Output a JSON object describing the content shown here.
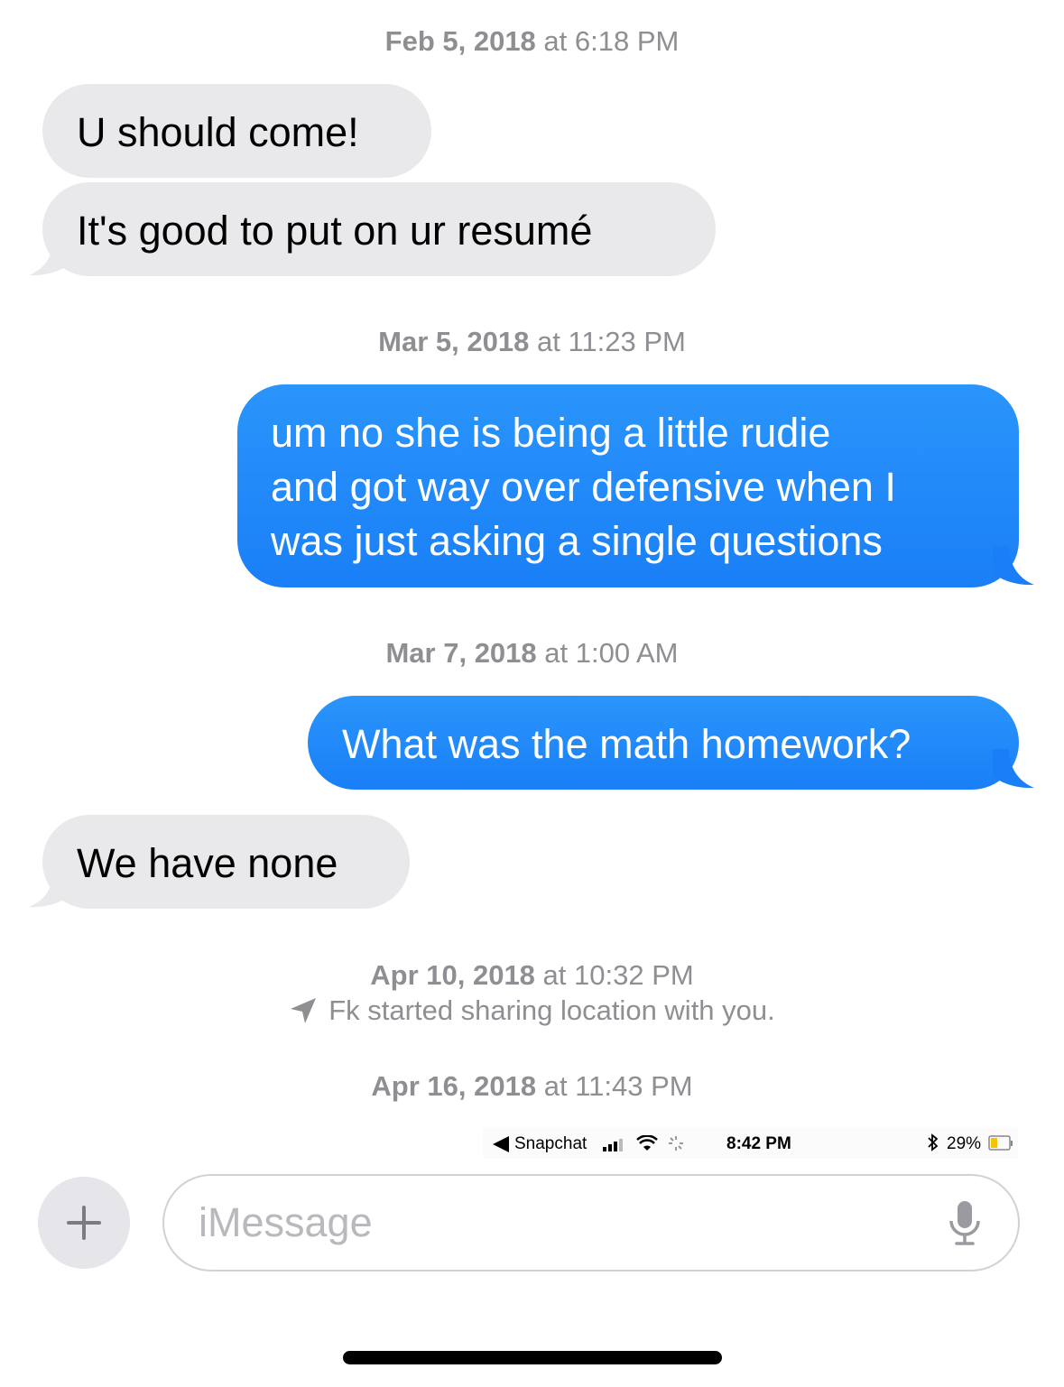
{
  "thread": {
    "ts1": {
      "date": "Feb 5, 2018",
      "at": "at",
      "time": "6:18 PM"
    },
    "msg1": "U should come!",
    "msg2": "It's good to put on ur resumé",
    "ts2": {
      "date": "Mar 5, 2018",
      "at": "at",
      "time": "11:23 PM"
    },
    "msg3_lines": [
      "um no she is being a little rudie",
      "and got way over defensive when I",
      "was just asking a single questions"
    ],
    "ts3": {
      "date": "Mar 7, 2018",
      "at": "at",
      "time": "1:00 AM"
    },
    "msg4": "What was the math homework?",
    "msg5": "We have none",
    "ts4": {
      "date": "Apr 10, 2018",
      "at": "at",
      "time": "10:32 PM"
    },
    "location_notice": "Fk started sharing location with you.",
    "ts5": {
      "date": "Apr 16, 2018",
      "at": "at",
      "time": "11:43 PM"
    }
  },
  "embedded_status": {
    "back_app": "Snapchat",
    "time": "8:42 PM",
    "battery": "29%"
  },
  "composer": {
    "placeholder": "iMessage"
  },
  "icons": [
    "plus-icon",
    "microphone-icon",
    "location-arrow-icon",
    "bluetooth-icon",
    "wifi-icon",
    "signal-icon",
    "battery-icon"
  ],
  "colors": {
    "sent_bubble": "#1a7ff7",
    "received_bubble": "#e9e9eb",
    "timestamp": "#8e8e93"
  }
}
